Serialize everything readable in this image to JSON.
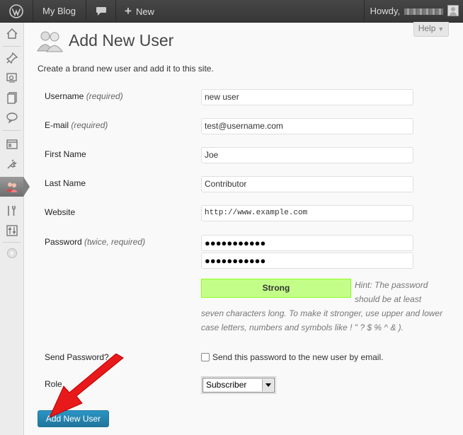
{
  "adminbar": {
    "logo_icon": "wordpress-logo-icon",
    "blog_name": "My Blog",
    "comments_icon": "comment-bubble-icon",
    "new_label": "New",
    "howdy": "Howdy,"
  },
  "help": {
    "label": "Help"
  },
  "sidebar": {
    "items": [
      "dashboard-icon",
      "posts-icon",
      "media-icon",
      "pages-icon",
      "comments-icon",
      "appearance-icon",
      "plugins-icon",
      "users-icon",
      "tools-icon",
      "settings-icon",
      "collapse-icon"
    ],
    "active": "users-icon"
  },
  "page": {
    "title": "Add New User",
    "intro": "Create a brand new user and add it to this site."
  },
  "form": {
    "username": {
      "label": "Username",
      "req": "(required)",
      "value": "new user"
    },
    "email": {
      "label": "E-mail",
      "req": "(required)",
      "value": "test@username.com"
    },
    "first_name": {
      "label": "First Name",
      "value": "Joe"
    },
    "last_name": {
      "label": "Last Name",
      "value": "Contributor"
    },
    "website": {
      "label": "Website",
      "value": "http://www.example.com"
    },
    "password": {
      "label": "Password",
      "req": "(twice, required)",
      "value1": "●●●●●●●●●●●",
      "value2": "●●●●●●●●●●●"
    },
    "strength": "Strong",
    "hint_1": "Hint: The password",
    "hint_2": "should be at least",
    "hint_3": "seven characters long. To make it stronger, use upper and lower",
    "hint_4": "case letters, numbers and symbols like ! \" ? $ % ^ & ).",
    "send_password": {
      "label": "Send Password?",
      "checkbox_text": "Send this password to the new user by email.",
      "checked": false
    },
    "role": {
      "label": "Role",
      "selected": "Subscriber"
    },
    "submit": "Add New User"
  },
  "colors": {
    "adminbar_bg": "#464646",
    "strength_bg": "#c3ff88",
    "button_blue": "#21759b",
    "annotation_arrow": "#e8191a"
  }
}
